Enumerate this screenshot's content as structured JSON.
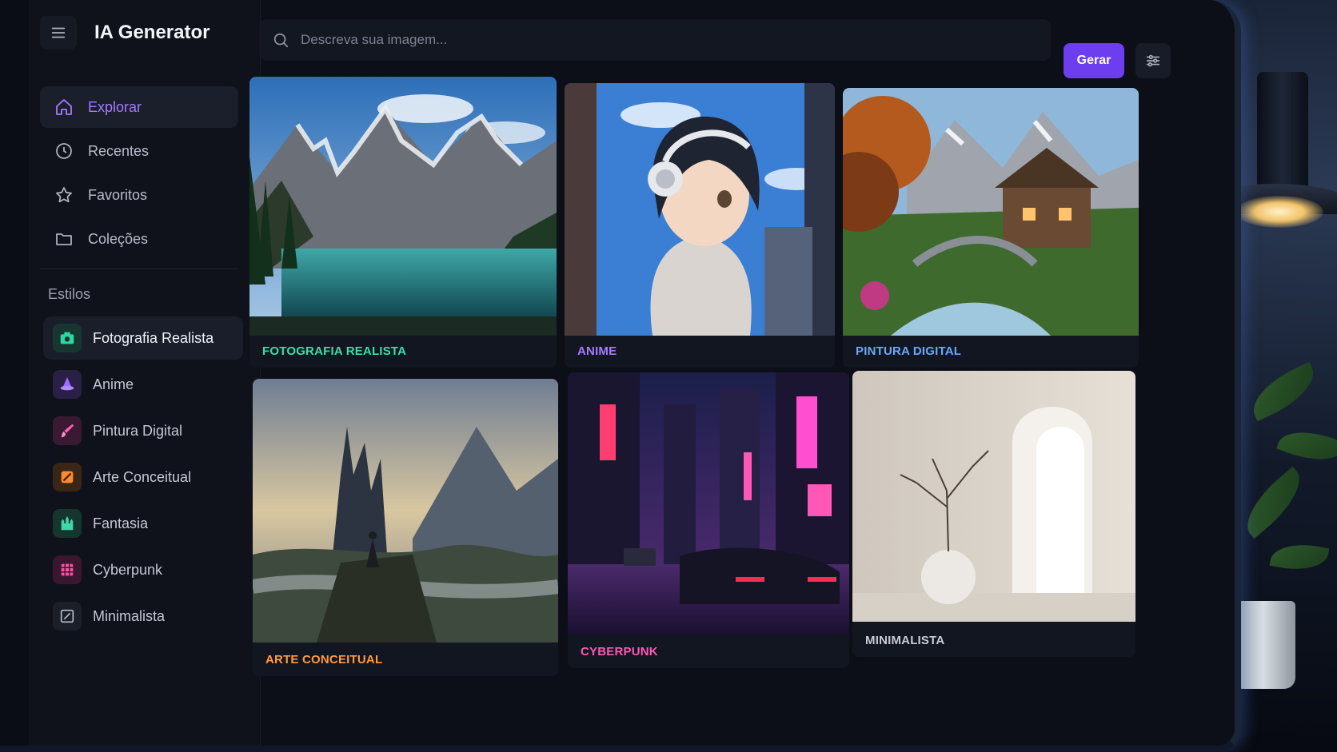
{
  "app": {
    "title": "IA Generator"
  },
  "search": {
    "placeholder": "Descreva sua imagem..."
  },
  "header": {
    "generate_label": "Gerar"
  },
  "nav": [
    {
      "label": "Explorar",
      "icon": "home-icon",
      "active": true
    },
    {
      "label": "Recentes",
      "icon": "clock-icon",
      "active": false
    },
    {
      "label": "Favoritos",
      "icon": "star-icon",
      "active": false
    },
    {
      "label": "Coleções",
      "icon": "folder-icon",
      "active": false
    }
  ],
  "styles_section": {
    "label": "Estilos"
  },
  "styles": [
    {
      "label": "Fotografia Realista",
      "icon": "camera-icon",
      "color": "#2fd5a3",
      "active": true
    },
    {
      "label": "Anime",
      "icon": "wizard-hat-icon",
      "color": "#9b6cff",
      "active": false
    },
    {
      "label": "Pintura Digital",
      "icon": "brush-icon",
      "color": "#ff5fb0",
      "active": false
    },
    {
      "label": "Arte Conceitual",
      "icon": "palette-icon",
      "color": "#ff8a2b",
      "active": false
    },
    {
      "label": "Fantasia",
      "icon": "castle-icon",
      "color": "#3fd6a8",
      "active": false
    },
    {
      "label": "Cyberpunk",
      "icon": "grid-icon",
      "color": "#ff4fa0",
      "active": false
    },
    {
      "label": "Minimalista",
      "icon": "square-slash-icon",
      "color": "#b8bdc9",
      "active": false
    }
  ],
  "gallery": [
    {
      "label": "FOTOGRAFIA REALISTA",
      "color": "#38e0a8"
    },
    {
      "label": "ANIME",
      "color": "#a57bff"
    },
    {
      "label": "PINTURA DIGITAL",
      "color": "#6aa8ff"
    },
    {
      "label": "ARTE CONCEITUAL",
      "color": "#ff9a3c"
    },
    {
      "label": "CYBERPUNK",
      "color": "#ff57b6"
    },
    {
      "label": "MINIMALISTA",
      "color": "#c9ccd3"
    }
  ]
}
